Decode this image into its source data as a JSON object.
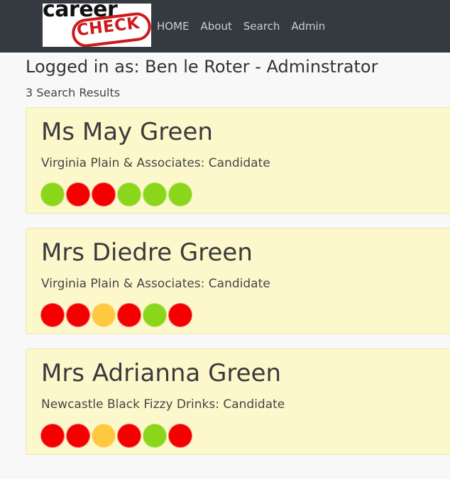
{
  "brand": {
    "logo_word1": "career",
    "logo_word2": "CHECK"
  },
  "nav": {
    "items": [
      {
        "label": "HOME"
      },
      {
        "label": "About"
      },
      {
        "label": "Search"
      },
      {
        "label": "Admin"
      }
    ]
  },
  "header": {
    "logged_in": "Logged in as: Ben le Roter - Adminstrator",
    "result_count": "3 Search Results"
  },
  "status_colors": {
    "green": "#8bd61a",
    "red": "#f40000",
    "amber": "#ffc93f"
  },
  "results": [
    {
      "name": "Ms May Green",
      "org": "Virginia Plain & Associates: Candidate",
      "indicators": [
        "green",
        "red",
        "red",
        "green",
        "green",
        "green"
      ]
    },
    {
      "name": "Mrs Diedre Green",
      "org": "Virginia Plain & Associates: Candidate",
      "indicators": [
        "red",
        "red",
        "amber",
        "red",
        "green",
        "red"
      ]
    },
    {
      "name": "Mrs Adrianna Green",
      "org": "Newcastle Black Fizzy Drinks: Candidate",
      "indicators": [
        "red",
        "red",
        "amber",
        "red",
        "green",
        "red"
      ]
    }
  ]
}
